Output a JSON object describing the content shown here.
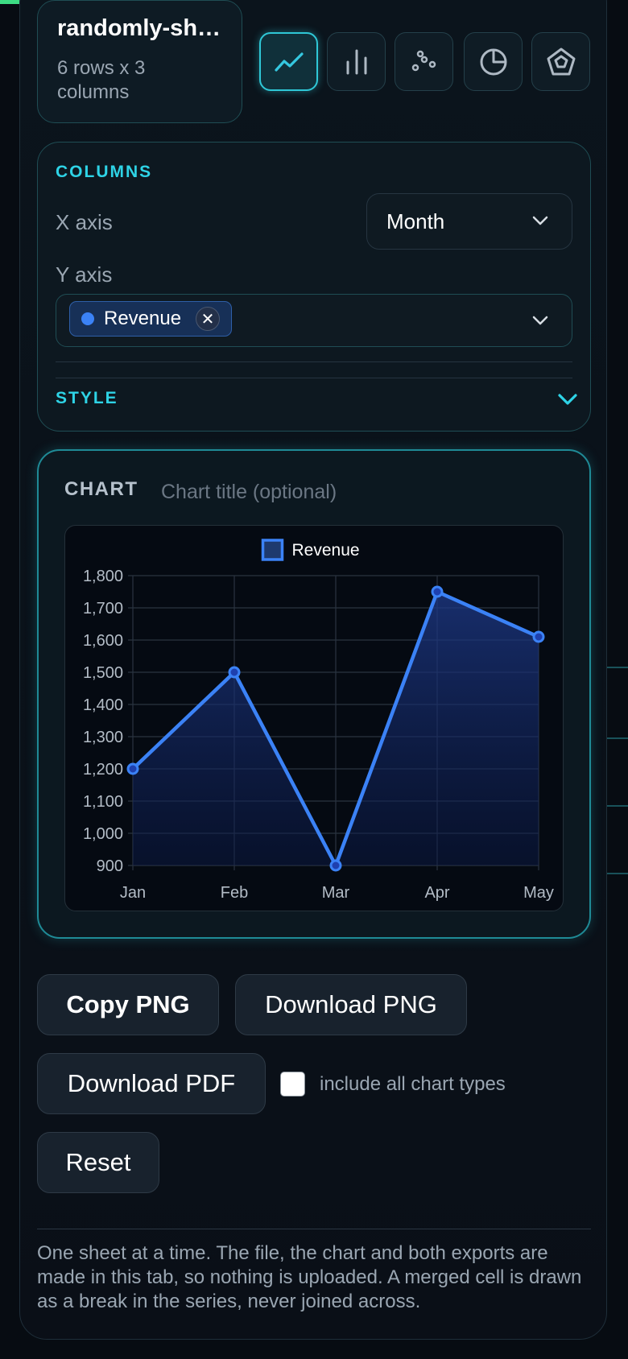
{
  "file": {
    "name": "randomly-sh…",
    "meta": "6 rows x 3 columns"
  },
  "chart_types": [
    {
      "icon": "line-chart-icon",
      "active": true
    },
    {
      "icon": "bar-chart-icon",
      "active": false
    },
    {
      "icon": "scatter-chart-icon",
      "active": false
    },
    {
      "icon": "pie-chart-icon",
      "active": false
    },
    {
      "icon": "radar-chart-icon",
      "active": false
    }
  ],
  "columns": {
    "title": "COLUMNS",
    "x_label": "X axis",
    "x_value": "Month",
    "y_label": "Y axis",
    "y_chip": "Revenue",
    "y_chip_remove": "✕"
  },
  "style": {
    "title": "STYLE"
  },
  "chart": {
    "label": "CHART",
    "title_placeholder": "Chart title (optional)"
  },
  "chart_data": {
    "type": "line",
    "categories": [
      "Jan",
      "Feb",
      "Mar",
      "Apr",
      "May"
    ],
    "series": [
      {
        "name": "Revenue",
        "values": [
          1200,
          1500,
          900,
          1750,
          1610
        ],
        "color": "#3b82f6"
      }
    ],
    "ylim": [
      900,
      1800
    ],
    "yticks": [
      900,
      1000,
      1100,
      1200,
      1300,
      1400,
      1500,
      1600,
      1700,
      1800
    ],
    "ytick_labels": [
      "900",
      "1,000",
      "1,100",
      "1,200",
      "1,300",
      "1,400",
      "1,500",
      "1,600",
      "1,700",
      "1,800"
    ],
    "grid": true,
    "fill": true,
    "legend": "top-center"
  },
  "actions": {
    "copy_png": "Copy PNG",
    "download_png": "Download PNG",
    "download_pdf": "Download PDF",
    "include_all": "include all chart types",
    "reset": "Reset"
  },
  "footer_note": "One sheet at a time. The file, the chart and both exports are made in this tab, so nothing is uploaded. A merged cell is drawn as a break in the series, never joined across.",
  "colors": {
    "accent": "#2ed3e6",
    "series": "#3b82f6",
    "progress": "#3ddc84"
  }
}
